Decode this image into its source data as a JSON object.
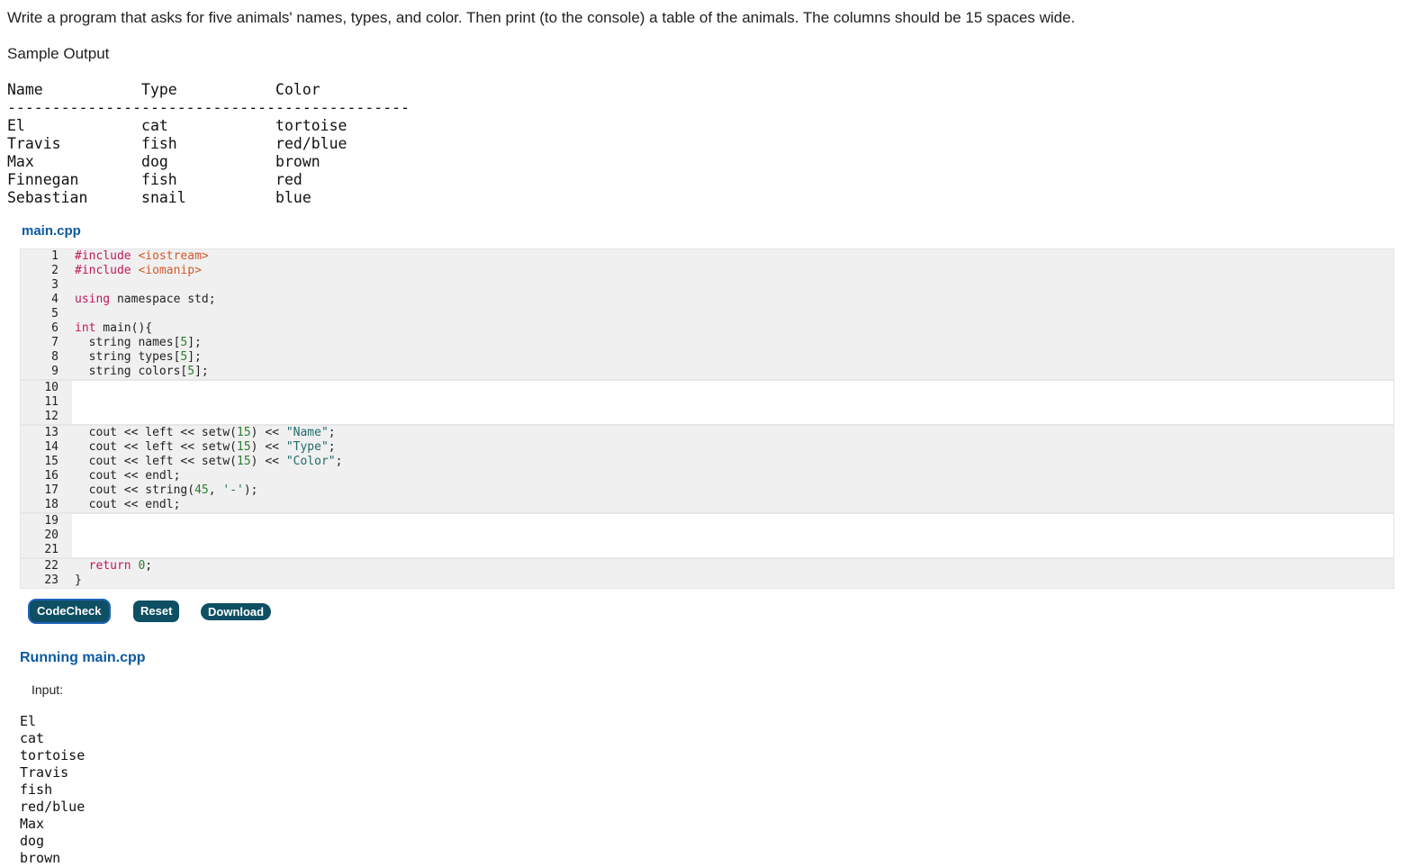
{
  "prompt": "Write a program that asks for five animals' names, types, and color. Then print (to the console) a table of the animals. The columns should be 15 spaces wide.",
  "sample_label": "Sample Output",
  "sample_table": {
    "headers": [
      "Name",
      "Type",
      "Color"
    ],
    "separator": "---------------------------------------------",
    "rows": [
      [
        "El",
        "cat",
        "tortoise"
      ],
      [
        "Travis",
        "fish",
        "red/blue"
      ],
      [
        "Max",
        "dog",
        "brown"
      ],
      [
        "Finnegan",
        "fish",
        "red"
      ],
      [
        "Sebastian",
        "snail",
        "blue"
      ]
    ]
  },
  "editor": {
    "file_name": "main.cpp",
    "segments": [
      {
        "type": "fixed",
        "lines": [
          {
            "n": "1",
            "tokens": [
              [
                "pp",
                "#include "
              ],
              [
                "inc",
                "<iostream>"
              ]
            ]
          },
          {
            "n": "2",
            "tokens": [
              [
                "pp",
                "#include "
              ],
              [
                "inc",
                "<iomanip>"
              ]
            ]
          },
          {
            "n": "3",
            "tokens": []
          },
          {
            "n": "4",
            "tokens": [
              [
                "kw",
                "using"
              ],
              [
                "",
                " namespace std;"
              ]
            ]
          },
          {
            "n": "5",
            "tokens": []
          },
          {
            "n": "6",
            "tokens": [
              [
                "kw",
                "int"
              ],
              [
                "",
                " main(){"
              ]
            ]
          },
          {
            "n": "7",
            "tokens": [
              [
                "",
                "  string names["
              ],
              [
                "num",
                "5"
              ],
              [
                "",
                "];"
              ]
            ]
          },
          {
            "n": "8",
            "tokens": [
              [
                "",
                "  string types["
              ],
              [
                "num",
                "5"
              ],
              [
                "",
                "];"
              ]
            ]
          },
          {
            "n": "9",
            "tokens": [
              [
                "",
                "  string colors["
              ],
              [
                "num",
                "5"
              ],
              [
                "",
                "];"
              ]
            ]
          }
        ]
      },
      {
        "type": "editable",
        "lines": [
          {
            "n": "10",
            "tokens": []
          },
          {
            "n": "11",
            "tokens": []
          },
          {
            "n": "12",
            "tokens": []
          }
        ]
      },
      {
        "type": "fixed",
        "lines": [
          {
            "n": "13",
            "tokens": [
              [
                "",
                "  cout << left << setw("
              ],
              [
                "num",
                "15"
              ],
              [
                "",
                ") << "
              ],
              [
                "str",
                "\"Name\""
              ],
              [
                "",
                ";"
              ]
            ]
          },
          {
            "n": "14",
            "tokens": [
              [
                "",
                "  cout << left << setw("
              ],
              [
                "num",
                "15"
              ],
              [
                "",
                ") << "
              ],
              [
                "str",
                "\"Type\""
              ],
              [
                "",
                ";"
              ]
            ]
          },
          {
            "n": "15",
            "tokens": [
              [
                "",
                "  cout << left << setw("
              ],
              [
                "num",
                "15"
              ],
              [
                "",
                ") << "
              ],
              [
                "str",
                "\"Color\""
              ],
              [
                "",
                ";"
              ]
            ]
          },
          {
            "n": "16",
            "tokens": [
              [
                "",
                "  cout << endl;"
              ]
            ]
          },
          {
            "n": "17",
            "tokens": [
              [
                "",
                "  cout << string("
              ],
              [
                "num",
                "45"
              ],
              [
                "",
                ", "
              ],
              [
                "str",
                "'-'"
              ],
              [
                "",
                ");"
              ]
            ]
          },
          {
            "n": "18",
            "tokens": [
              [
                "",
                "  cout << endl;"
              ]
            ]
          }
        ]
      },
      {
        "type": "editable",
        "lines": [
          {
            "n": "19",
            "tokens": []
          },
          {
            "n": "20",
            "tokens": []
          },
          {
            "n": "21",
            "tokens": []
          }
        ]
      },
      {
        "type": "fixed",
        "lines": [
          {
            "n": "22",
            "tokens": [
              [
                "",
                "  "
              ],
              [
                "kw",
                "return"
              ],
              [
                "",
                " "
              ],
              [
                "num",
                "0"
              ],
              [
                "",
                ";"
              ]
            ]
          },
          {
            "n": "23",
            "tokens": [
              [
                "",
                "}"
              ]
            ]
          }
        ]
      }
    ]
  },
  "buttons": {
    "codecheck": "CodeCheck",
    "reset": "Reset",
    "download": "Download"
  },
  "run": {
    "title": "Running main.cpp",
    "input_label": "Input:",
    "input_lines": [
      "El",
      "cat",
      "tortoise",
      "Travis",
      "fish",
      "red/blue",
      "Max",
      "dog",
      "brown"
    ]
  },
  "colors": {
    "accent_title": "#0b5aa0",
    "button_bg": "#0e4f63",
    "keyword": "#c2185b",
    "include": "#d35a2c",
    "number": "#2e7d32",
    "string": "#1f6b6b"
  }
}
